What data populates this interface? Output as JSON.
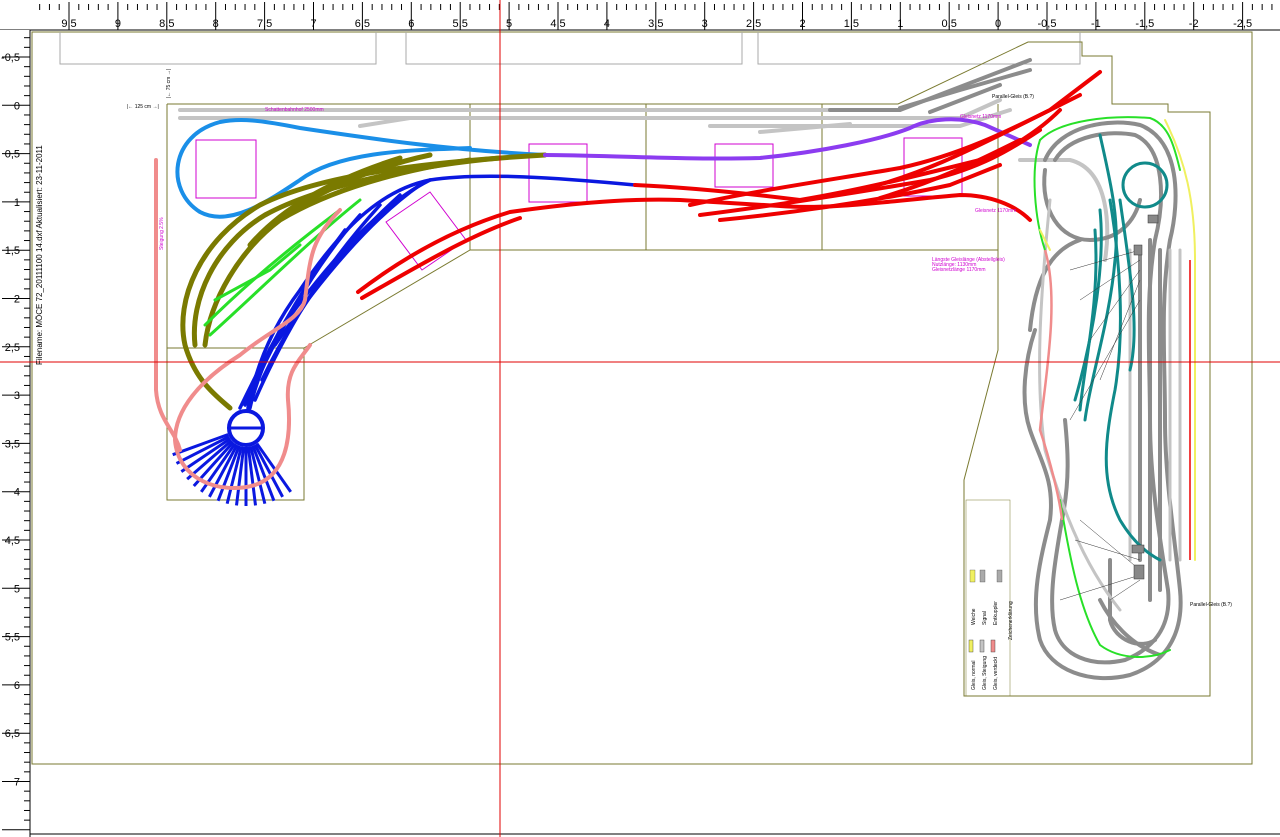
{
  "ruler": {
    "x_labels": [
      "9,5",
      "9",
      "8,5",
      "8",
      "7,5",
      "7",
      "6,5",
      "6",
      "5,5",
      "5",
      "4,5",
      "4",
      "3,5",
      "3",
      "2,5",
      "2",
      "1,5",
      "1",
      "0,5",
      "0",
      "-0,5",
      "-1",
      "-1,5",
      "-2",
      "-2,5"
    ],
    "y_labels": [
      "-0,5",
      "0",
      "0,5",
      "1",
      "1,5",
      "2",
      "2,5",
      "3",
      "3,5",
      "4",
      "4,5",
      "5",
      "5,5",
      "6",
      "6,5",
      "7"
    ]
  },
  "layout": {
    "title_vertical": "Filename: MÖCE 72_20111100 14.dxf    Aktualisiert: 23-11-2011",
    "annotations": {
      "dim_125": "|← 125 cm →|",
      "dim_75": "|← 75 cm →|",
      "steig_left": "Steigung 2.5%",
      "top_mag": "Schattenbahnhof 2500mm",
      "gleisnetz_1": "Gleisnetz 1170mm",
      "gleisnetz_2": "Gleisnetz 1170mm",
      "laengste_1": "Längste Gleislänge (Abstellgleis)",
      "laengste_2": "Nutzlänge: 1130mm",
      "laengste_3": "Gleisnetzlänge 1170mm",
      "parallel_top": "Parallel-Gleis (B.?)",
      "parallel_bot": "Parallel-Gleis (B.?)"
    },
    "legend_title": "Zeichenerklärung",
    "legend_items": [
      "Gleis, normal",
      "Gleis, Steigung",
      "Gleis, verdeckt",
      "Weiche",
      "Signal",
      "Entkuppler"
    ]
  },
  "colors": {
    "grey": "#8c8c8c",
    "light_grey": "#c4c4c4",
    "red": "#ee0000",
    "blue": "#0a18e0",
    "light_blue": "#1a8fe8",
    "olive": "#7a7a00",
    "purple": "#8c3cf0",
    "green": "#28e028",
    "salmon": "#f08c8c",
    "teal": "#108a8a",
    "magenta": "#d000d0",
    "board": "#7a7a30",
    "crosshair": "#e00000",
    "yellow": "#f0f060"
  }
}
